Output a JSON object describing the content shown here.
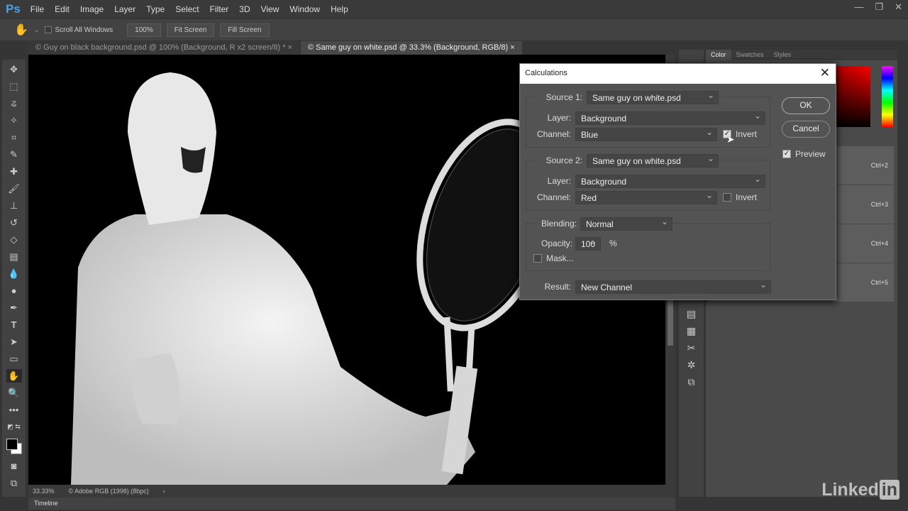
{
  "app": {
    "logo": "Ps"
  },
  "menu": [
    "File",
    "Edit",
    "Image",
    "Layer",
    "Type",
    "Select",
    "Filter",
    "3D",
    "View",
    "Window",
    "Help"
  ],
  "options": {
    "scroll_all": "Scroll All Windows",
    "zoom": "100%",
    "fit": "Fit Screen",
    "fill": "Fill Screen"
  },
  "tabs": [
    {
      "label": "© Guy on black background.psd @ 100% (Background, R x2 screen/8) *"
    },
    {
      "label": "© Same guy on white.psd @ 33.3% (Background, RGB/8)"
    }
  ],
  "status": {
    "zoom": "33.33%",
    "profile": "© Adobe RGB (1998) (8bpc)"
  },
  "timeline": "Timeline",
  "panel": {
    "tabs": [
      "Color",
      "Swatches",
      "Styles"
    ],
    "shortcuts": [
      "Ctrl+2",
      "Ctrl+3",
      "Ctrl+4",
      "Ctrl+5"
    ]
  },
  "dialog": {
    "title": "Calculations",
    "source1": {
      "label": "Source 1:",
      "value": "Same guy on white.psd",
      "layer_label": "Layer:",
      "layer": "Background",
      "channel_label": "Channel:",
      "channel": "Blue",
      "invert_label": "Invert",
      "invert": true
    },
    "source2": {
      "label": "Source 2:",
      "value": "Same guy on white.psd",
      "layer_label": "Layer:",
      "layer": "Background",
      "channel_label": "Channel:",
      "channel": "Red",
      "invert_label": "Invert",
      "invert": false
    },
    "blending_label": "Blending:",
    "blending": "Normal",
    "opacity_label": "Opacity:",
    "opacity": "100",
    "percent": "%",
    "mask_label": "Mask...",
    "mask": false,
    "result_label": "Result:",
    "result": "New Channel",
    "ok": "OK",
    "cancel": "Cancel",
    "preview_label": "Preview",
    "preview": true
  },
  "watermark": "LinkedIn"
}
